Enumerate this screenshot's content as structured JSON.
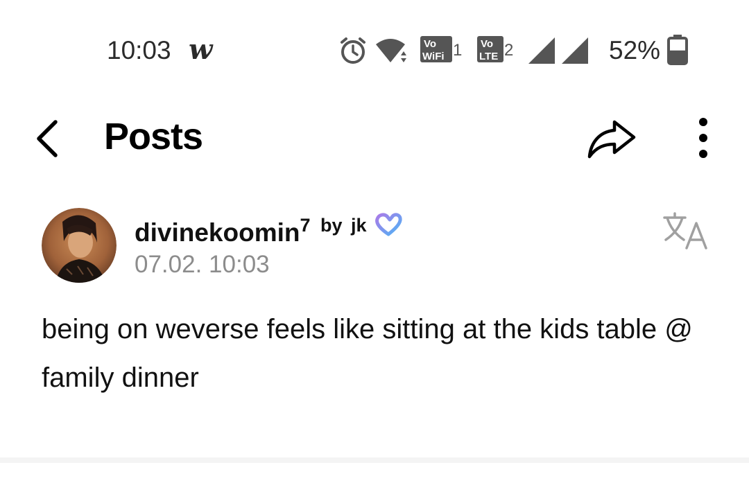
{
  "status_bar": {
    "time": "10:03",
    "app_icon": "weverse-w-icon",
    "app_glyph": "w",
    "vowifi_top": "Vo",
    "vowifi_bottom": "WiFi",
    "vowifi_sim": "1",
    "volte_top": "Vo",
    "volte_bottom": "LTE",
    "volte_sim": "2",
    "battery_percent": "52%",
    "battery_level": 0.52,
    "icons": [
      "alarm-icon",
      "wifi-icon",
      "vowifi-icon",
      "volte-icon",
      "signal-icon",
      "signal-icon",
      "battery-icon"
    ]
  },
  "header": {
    "title": "Posts",
    "icons": [
      "back-icon",
      "share-icon",
      "more-vertical-icon"
    ]
  },
  "post": {
    "author_name": "divinekoomin",
    "author_superscript": "7",
    "by_label": "by",
    "by_name": "jk",
    "timestamp": "07.02. 10:03",
    "body": "being on weverse feels like sitting at the kids table @ family dinner",
    "icons": [
      "avatar",
      "heart-icon",
      "translate-icon"
    ]
  },
  "colors": {
    "text": "#111111",
    "secondary_text": "#8c8c8c",
    "heart_gradient_start": "#a97be8",
    "heart_gradient_end": "#4fb3f5",
    "divider": "#f4f4f4"
  }
}
